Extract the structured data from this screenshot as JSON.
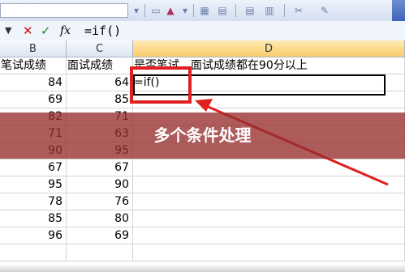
{
  "toolbar": {
    "icons": [
      "print-icon",
      "font-color-icon",
      "border-icon",
      "align-icon",
      "merge-icon",
      "chart-icon",
      "tools-icon"
    ]
  },
  "formula_bar": {
    "cancel": "✕",
    "confirm": "✓",
    "fx": "fx",
    "formula": "=if()"
  },
  "columns": [
    "B",
    "C",
    "D"
  ],
  "header_row": {
    "b": "笔试成绩",
    "c": "面试成绩",
    "d": "是否笔试、面试成绩都在90分以上"
  },
  "active_cell_value": "=if()",
  "rows": [
    {
      "b": "84",
      "c": "64"
    },
    {
      "b": "69",
      "c": "85"
    },
    {
      "b": "82",
      "c": "71"
    },
    {
      "b": "71",
      "c": "63"
    },
    {
      "b": "90",
      "c": "95"
    },
    {
      "b": "67",
      "c": "67"
    },
    {
      "b": "95",
      "c": "90"
    },
    {
      "b": "78",
      "c": "76"
    },
    {
      "b": "85",
      "c": "80"
    },
    {
      "b": "96",
      "c": "69"
    }
  ],
  "banner": {
    "text": "多个条件处理",
    "color": "#962d2d"
  },
  "annotation_color": "#e02020"
}
